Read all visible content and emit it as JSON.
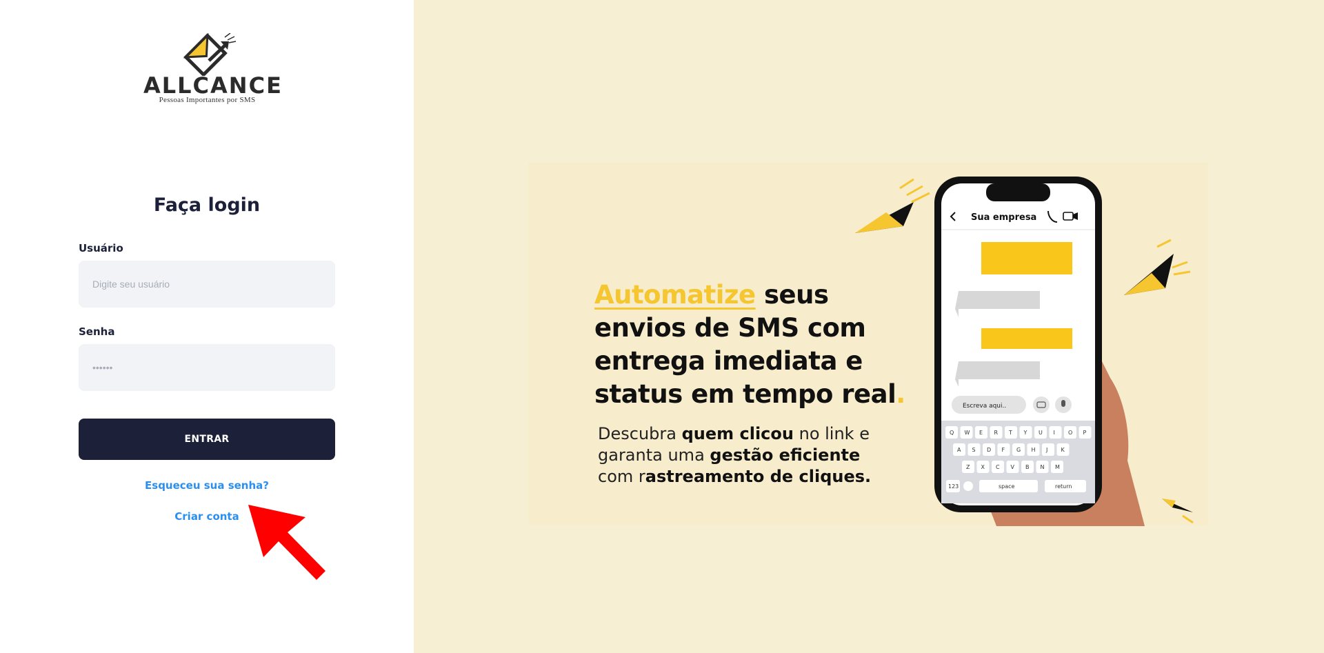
{
  "brand": {
    "name": "ALLCANCE",
    "tagline": "Pessoas Importantes por SMS"
  },
  "login": {
    "title": "Faça login",
    "username_label": "Usuário",
    "username_placeholder": "Digite seu usuário",
    "password_label": "Senha",
    "password_placeholder": "••••••",
    "submit_label": "ENTRAR",
    "forgot_link": "Esqueceu sua senha?",
    "create_account_link": "Criar conta"
  },
  "banner": {
    "headline_accent": "Automatize",
    "headline_line1_rest": " seus",
    "headline_line2": "envios de SMS com",
    "headline_line3": "entrega imediata e",
    "headline_line4": "status em tempo real",
    "headline_dot": ".",
    "sub_line1_pre": "Descubra ",
    "sub_line1_bold": "quem clicou",
    "sub_line1_post": " no link e",
    "sub_line2_pre": "garanta uma ",
    "sub_line2_bold": "gestão eficiente",
    "sub_line3_pre": "com r",
    "sub_line3_bold": "astreamento de cliques."
  },
  "phone": {
    "contact_name": "Sua empresa",
    "input_placeholder": "Escreva aqui..",
    "keyboard_row1": [
      "Q",
      "W",
      "E",
      "R",
      "T",
      "Y",
      "U",
      "I",
      "O",
      "P"
    ],
    "keyboard_row2": [
      "A",
      "S",
      "D",
      "F",
      "G",
      "H",
      "J",
      "K"
    ],
    "keyboard_row3": [
      "Z",
      "X",
      "C",
      "V",
      "B",
      "N",
      "M"
    ],
    "key_123": "123",
    "key_space": "space",
    "key_return": "return"
  },
  "colors": {
    "brand_dark": "#1c2038",
    "link_blue": "#2b8ff0",
    "accent_yellow": "#f5c62f",
    "background_cream": "#f6efd3",
    "annotation_arrow": "#ff0000"
  }
}
